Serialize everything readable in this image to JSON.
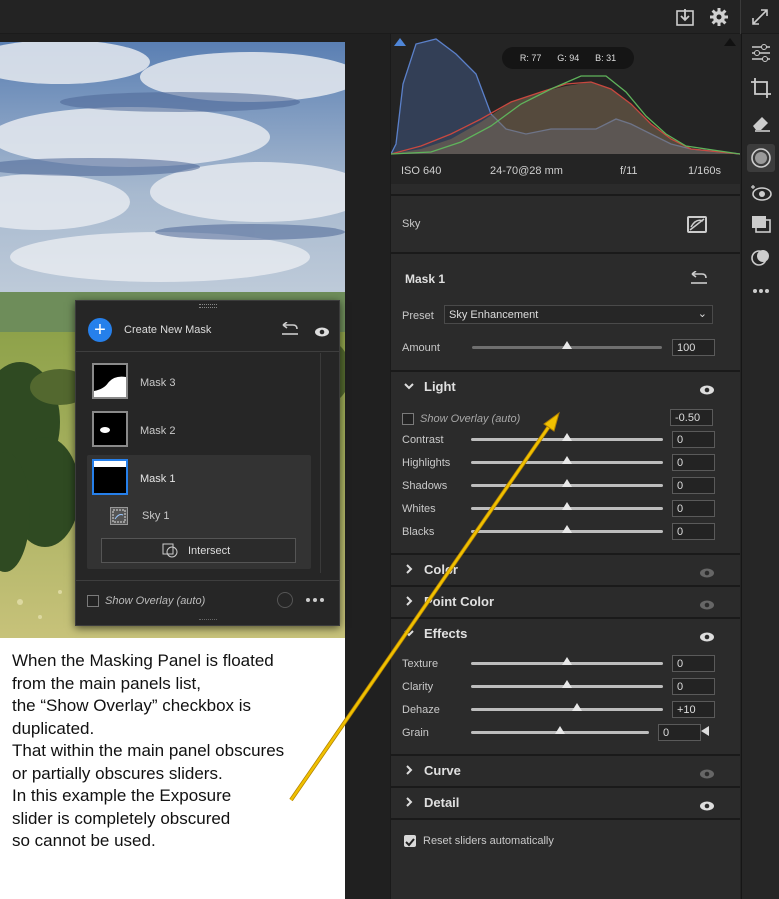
{
  "toolbar": {
    "export_icon": "export-icon",
    "settings_icon": "gear-icon",
    "expand_icon": "expand-icon"
  },
  "note": {
    "text": "When the Masking Panel is floated\nfrom the main panels list,\nthe “Show Overlay” checkbox is\nduplicated.\nThat within the main panel obscures\nor partially obscures sliders.\nIn this example the Exposure\nslider is completely obscured\nso cannot be used."
  },
  "histogram": {
    "r": "R: 77",
    "g": "G: 94",
    "b": "B: 31",
    "iso": "ISO 640",
    "lens": "24-70@28 mm",
    "aperture": "f/11",
    "shutter": "1/160s"
  },
  "sky": {
    "label": "Sky"
  },
  "mask": {
    "title": "Mask 1",
    "preset_label": "Preset",
    "preset_value": "Sky Enhancement",
    "amount_label": "Amount",
    "amount_value": "100",
    "amount_level": 0.5
  },
  "light": {
    "title": "Light",
    "overlay_label": "Show Overlay (auto)",
    "exposure_value": "-0.50",
    "sliders": [
      {
        "label": "Contrast",
        "value": "0",
        "level": 0.5
      },
      {
        "label": "Highlights",
        "value": "0",
        "level": 0.5
      },
      {
        "label": "Shadows",
        "value": "0",
        "level": 0.5
      },
      {
        "label": "Whites",
        "value": "0",
        "level": 0.5
      },
      {
        "label": "Blacks",
        "value": "0",
        "level": 0.5
      }
    ]
  },
  "color": {
    "title": "Color"
  },
  "point_color": {
    "title": "Point Color"
  },
  "effects": {
    "title": "Effects",
    "sliders": [
      {
        "label": "Texture",
        "value": "0",
        "level": 0.5
      },
      {
        "label": "Clarity",
        "value": "0",
        "level": 0.5
      },
      {
        "label": "Dehaze",
        "value": "+10",
        "level": 0.55
      },
      {
        "label": "Grain",
        "value": "0",
        "level": 0.5
      }
    ]
  },
  "curve": {
    "title": "Curve"
  },
  "detail": {
    "title": "Detail"
  },
  "reset": {
    "label": "Reset sliders automatically"
  },
  "floating": {
    "create_label": "Create New Mask",
    "masks": [
      {
        "name": "Mask 3"
      },
      {
        "name": "Mask 2"
      },
      {
        "name": "Mask 1"
      }
    ],
    "component": "Sky 1",
    "intersect_label": "Intersect",
    "overlay_label": "Show Overlay (auto)"
  },
  "colors": {
    "accent": "#2680eb",
    "arrow": "#f0c000"
  }
}
